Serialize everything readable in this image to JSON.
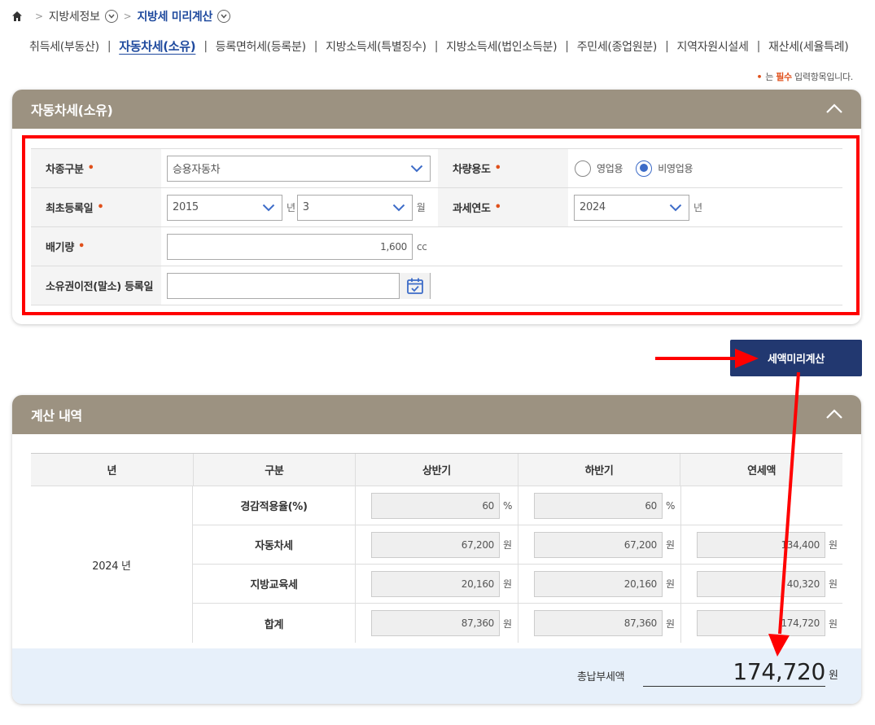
{
  "breadcrumb": {
    "home_icon": "home-icon",
    "level1": "지방세정보",
    "level2": "지방세 미리계산"
  },
  "tabs": [
    {
      "label": "취득세(부동산)"
    },
    {
      "label": "자동차세(소유)",
      "active": true
    },
    {
      "label": "등록면허세(등록분)"
    },
    {
      "label": "지방소득세(특별징수)"
    },
    {
      "label": "지방소득세(법인소득분)"
    },
    {
      "label": "주민세(종업원분)"
    },
    {
      "label": "지역자원시설세"
    },
    {
      "label": "재산세(세율특례)"
    }
  ],
  "required_note": {
    "dot": "•",
    "prefix": "는 ",
    "word": "필수",
    "suffix": " 입력항목입니다."
  },
  "form_panel": {
    "title": "자동차세(소유)",
    "vehicle_type_label": "차종구분",
    "vehicle_type_value": "승용자동차",
    "usage_label": "차량용도",
    "usage_options": [
      "영업용",
      "비영업용"
    ],
    "usage_selected": "비영업용",
    "first_reg_label": "최초등록일",
    "first_reg_year": "2015",
    "first_reg_year_unit": "년",
    "first_reg_month": "3",
    "first_reg_month_unit": "월",
    "tax_year_label": "과세연도",
    "tax_year_value": "2024",
    "tax_year_unit": "년",
    "displacement_label": "배기량",
    "displacement_value": "1,600",
    "displacement_unit": "cc",
    "transfer_label": "소유권이전(말소) 등록일",
    "transfer_value": "",
    "required_mark": "•"
  },
  "calc_button_label": "세액미리계산",
  "result_panel": {
    "title": "계산 내역",
    "headers": [
      "년",
      "구분",
      "상반기",
      "하반기",
      "연세액"
    ],
    "year": "2024 년",
    "rows": [
      {
        "label": "경감적용율(%)",
        "first": "60",
        "second": "60",
        "annual": "",
        "unit": "%"
      },
      {
        "label": "자동차세",
        "first": "67,200",
        "second": "67,200",
        "annual": "134,400",
        "unit": "원"
      },
      {
        "label": "지방교육세",
        "first": "20,160",
        "second": "20,160",
        "annual": "40,320",
        "unit": "원"
      },
      {
        "label": "합계",
        "first": "87,360",
        "second": "87,360",
        "annual": "174,720",
        "unit": "원"
      }
    ],
    "total_label": "총납부세액",
    "total_value": "174,720",
    "total_unit": "원"
  },
  "colors": {
    "accent": "#1f4a9e",
    "panel_header": "#9c9281",
    "button": "#223870",
    "annotation": "#ff0000"
  }
}
